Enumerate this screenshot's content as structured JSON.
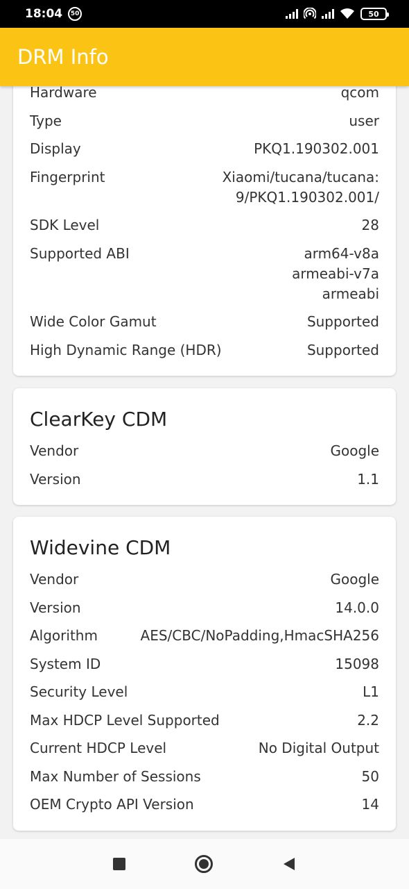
{
  "status": {
    "time": "18:04",
    "badge": "50",
    "battery": "50"
  },
  "appbar": {
    "title": "DRM Info"
  },
  "device_card": {
    "rows": [
      {
        "key": "Hardware",
        "value": "qcom"
      },
      {
        "key": "Type",
        "value": "user"
      },
      {
        "key": "Display",
        "value": "PKQ1.190302.001"
      },
      {
        "key": "Fingerprint",
        "value": "Xiaomi/tucana/tucana:",
        "value2": "9/PKQ1.190302.001/"
      },
      {
        "key": "SDK Level",
        "value": "28"
      },
      {
        "key": "Supported ABI",
        "value": "arm64-v8a",
        "value2": "armeabi-v7a",
        "value3": "armeabi"
      },
      {
        "key": "Wide Color Gamut",
        "value": "Supported"
      },
      {
        "key": "High Dynamic Range (HDR)",
        "value": "Supported"
      }
    ]
  },
  "clearkey_card": {
    "title": "ClearKey CDM",
    "rows": [
      {
        "key": "Vendor",
        "value": "Google"
      },
      {
        "key": "Version",
        "value": "1.1"
      }
    ]
  },
  "widevine_card": {
    "title": "Widevine CDM",
    "rows": [
      {
        "key": "Vendor",
        "value": "Google"
      },
      {
        "key": "Version",
        "value": "14.0.0"
      },
      {
        "key": "Algorithm",
        "value": "AES/CBC/NoPadding,HmacSHA256"
      },
      {
        "key": "System ID",
        "value": "15098"
      },
      {
        "key": "Security Level",
        "value": "L1"
      },
      {
        "key": "Max HDCP Level Supported",
        "value": "2.2"
      },
      {
        "key": "Current HDCP Level",
        "value": "No Digital Output"
      },
      {
        "key": "Max Number of Sessions",
        "value": "50"
      },
      {
        "key": "OEM Crypto API Version",
        "value": "14"
      }
    ]
  },
  "navbar": {
    "recents_icon": "square-recents-icon",
    "home_icon": "circle-home-icon",
    "back_icon": "triangle-back-icon"
  }
}
